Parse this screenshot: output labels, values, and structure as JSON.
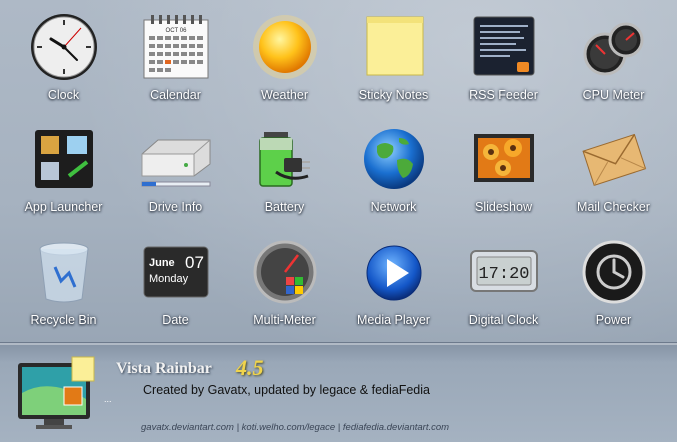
{
  "gadgets": [
    {
      "icon": "clock-icon",
      "label": "Clock"
    },
    {
      "icon": "calendar-icon",
      "label": "Calendar",
      "calendar_month": "OCT 06"
    },
    {
      "icon": "weather-sun-icon",
      "label": "Weather"
    },
    {
      "icon": "sticky-note-icon",
      "label": "Sticky Notes"
    },
    {
      "icon": "rss-feed-icon",
      "label": "RSS Feeder"
    },
    {
      "icon": "cpu-meter-icon",
      "label": "CPU Meter"
    },
    {
      "icon": "app-launcher-icon",
      "label": "App Launcher"
    },
    {
      "icon": "drive-icon",
      "label": "Drive Info"
    },
    {
      "icon": "battery-plug-icon",
      "label": "Battery"
    },
    {
      "icon": "globe-icon",
      "label": "Network"
    },
    {
      "icon": "slideshow-icon",
      "label": "Slideshow"
    },
    {
      "icon": "envelope-icon",
      "label": "Mail Checker"
    },
    {
      "icon": "recycle-bin-icon",
      "label": "Recycle Bin"
    },
    {
      "icon": "date-icon",
      "label": "Date",
      "date_month": "June",
      "date_day": "07",
      "date_weekday": "Monday"
    },
    {
      "icon": "multi-meter-icon",
      "label": "Multi-Meter"
    },
    {
      "icon": "play-icon",
      "label": "Media Player"
    },
    {
      "icon": "digital-clock-icon",
      "label": "Digital Clock",
      "display_time": "17:20"
    },
    {
      "icon": "power-icon",
      "label": "Power"
    }
  ],
  "footer": {
    "title": "Vista Rainbar",
    "version": "4.5",
    "credits": "Created by Gavatx, updated by legace & fediaFedia",
    "links": "gavatx.deviantart.com | koti.welho.com/legace | fediafedia.deviantart.com",
    "ellipsis": "..."
  },
  "colors": {
    "background": "#a6b2c0",
    "label_text": "#ffffff",
    "version_text": "#f1d44b"
  }
}
